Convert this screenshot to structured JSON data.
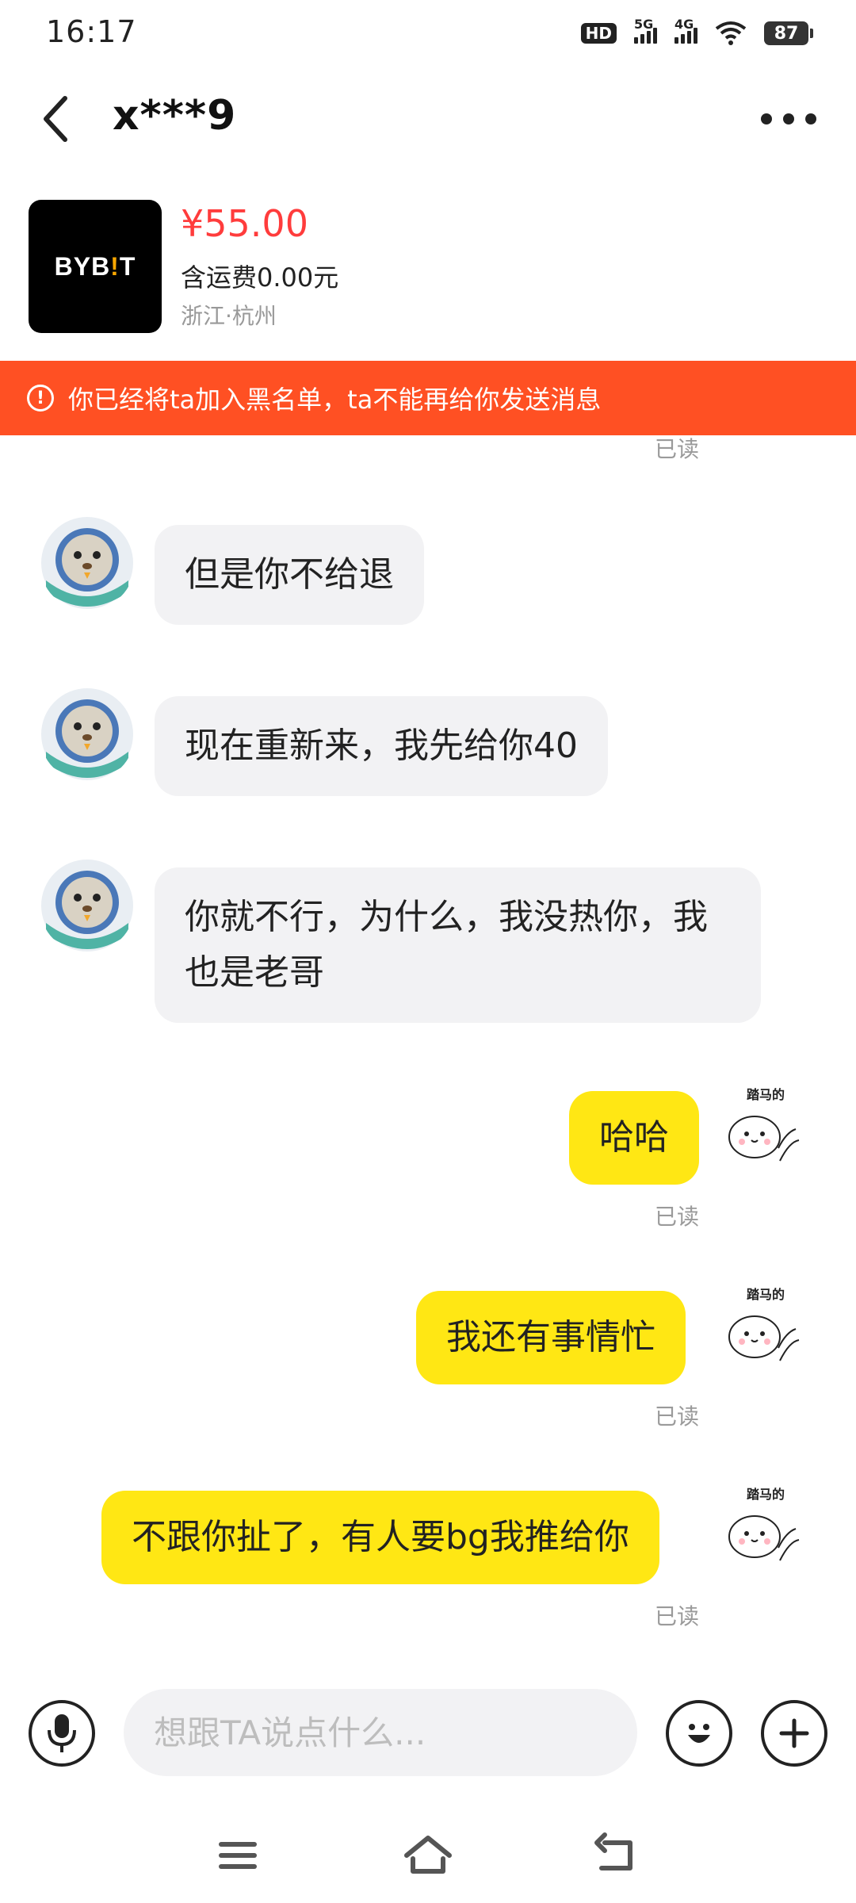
{
  "status": {
    "time": "16:17",
    "hd": "HD",
    "net1": "5G",
    "net2": "4G",
    "battery": "87"
  },
  "header": {
    "contact_name": "x***9"
  },
  "product": {
    "logo_text_a": "BYB",
    "logo_text_b": "!",
    "logo_text_c": "T",
    "price": "¥55.00",
    "shipping": "含运费0.00元",
    "location": "浙江·杭州"
  },
  "notice": {
    "icon": "!",
    "text": "你已经将ta加入黑名单，ta不能再给你发送消息"
  },
  "messages": [
    {
      "side": "read-top",
      "status": "已读"
    },
    {
      "side": "left",
      "text": "但是你不给退"
    },
    {
      "side": "left",
      "text": "现在重新来，我先给你40"
    },
    {
      "side": "left",
      "text": "你就不行，为什么，我没热你，我也是老哥"
    },
    {
      "side": "right",
      "text": "哈哈",
      "status": "已读"
    },
    {
      "side": "right",
      "text": "我还有事情忙",
      "status": "已读"
    },
    {
      "side": "right",
      "text": "不跟你扯了，有人要bg我推给你",
      "status": "已读"
    }
  ],
  "sticker_caption": "踏马的",
  "sticker_side": "006",
  "composer": {
    "placeholder": "想跟TA说点什么..."
  },
  "icons": {
    "back": "chevron-left-icon",
    "more": "more-dots-icon",
    "mic": "microphone-icon",
    "emoji": "emoji-icon",
    "plus": "plus-icon",
    "nav_menu": "menu-icon",
    "nav_home": "home-icon",
    "nav_back": "back-icon"
  }
}
